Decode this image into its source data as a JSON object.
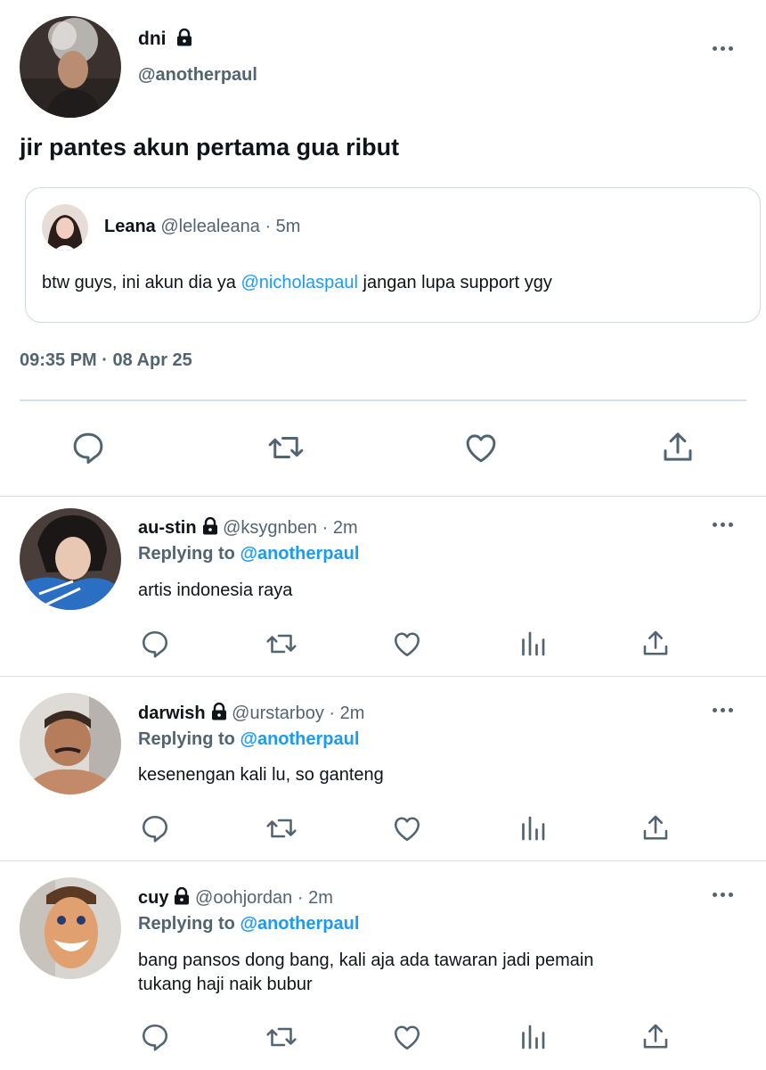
{
  "main_tweet": {
    "display_name": "dni",
    "handle": "@anotherpaul",
    "text": "jir pantes akun pertama gua ribut",
    "timestamp": "09:35 PM · 08 Apr 25",
    "quote": {
      "display_name": "Leana",
      "handle": "@lelealeana",
      "time": "· 5m",
      "text_before": "btw guys, ini akun dia ya ",
      "mention": "@nicholaspaul",
      "text_after": " jangan lupa support ygy"
    }
  },
  "replies": [
    {
      "display_name": "au-stin",
      "handle": "@ksygnben",
      "time": "· 2m",
      "replying_label": "Replying to",
      "replying_to": "@anotherpaul",
      "text_line1": "artis indonesia raya",
      "text_line2": ""
    },
    {
      "display_name": "darwish",
      "handle": "@urstarboy",
      "time": "· 2m",
      "replying_label": "Replying to",
      "replying_to": "@anotherpaul",
      "text_line1": "kesenengan kali lu, so ganteng",
      "text_line2": ""
    },
    {
      "display_name": "cuy",
      "handle": "@oohjordan",
      "time": "· 2m",
      "replying_label": "Replying to",
      "replying_to": "@anotherpaul",
      "text_line1": "bang pansos dong bang, kali aja ada tawaran jadi pemain",
      "text_line2": "tukang haji naik bubur"
    }
  ],
  "colors": {
    "text": "#0f1419",
    "muted": "#536471",
    "accent": "#1d9bf0",
    "divider": "#d9dee3"
  },
  "icons": [
    "lock-icon",
    "more-icon",
    "reply-icon",
    "retweet-icon",
    "like-icon",
    "views-icon",
    "share-icon"
  ]
}
